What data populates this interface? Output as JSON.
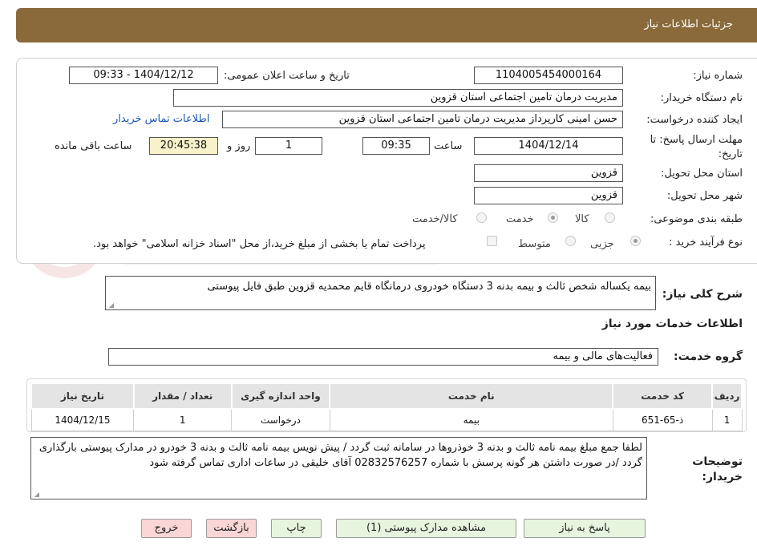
{
  "header": {
    "title": "جزئیات اطلاعات نیاز"
  },
  "form": {
    "need_number_label": "شماره نیاز:",
    "need_number": "1104005454000164",
    "announce_label": "تاریخ و ساعت اعلان عمومی:",
    "announce_value": "1404/12/12 - 09:33",
    "buyer_label": "نام دستگاه خریدار:",
    "buyer_value": "مدیریت درمان تامین اجتماعی استان قزوین",
    "creator_label": "ایجاد کننده درخواست:",
    "creator_value": "حسن امینی کارپرداز مدیریت درمان تامین اجتماعی استان قزوین",
    "contact_link": "اطلاعات تماس خریدار",
    "deadline_label": "مهلت ارسال پاسخ: تا تاریخ:",
    "deadline_date": "1404/12/14",
    "time_label": "ساعت",
    "deadline_time": "09:35",
    "days_value": "1",
    "days_label": "روز و",
    "remaining_value": "20:45:38",
    "remaining_label": "ساعت باقی مانده",
    "province_label": "استان محل تحویل:",
    "province_value": "قزوین",
    "city_label": "شهر محل تحویل:",
    "city_value": "قزوین",
    "category_label": "طبقه بندی موضوعی:",
    "category_options": [
      "کالا",
      "خدمت",
      "کالا/خدمت"
    ],
    "process_label": "نوع فرآیند خرید :",
    "process_options": [
      "جزیی",
      "متوسط"
    ],
    "payment_note": "پرداخت تمام یا بخشی از مبلغ خرید،از محل \"اسناد خزانه اسلامی\" خواهد بود."
  },
  "summary": {
    "label": "شرح کلی نیاز:",
    "value": "بیمه یکساله شخص ثالث و بیمه بدنه 3 دستگاه خودروی درمانگاه قایم محمدیه قزوین  طبق فایل پیوستی"
  },
  "services": {
    "section_title": "اطلاعات خدمات مورد نیاز",
    "group_label": "گروه خدمت:",
    "group_value": "فعالیت‌های مالی و بیمه",
    "columns": [
      "ردیف",
      "کد خدمت",
      "نام خدمت",
      "واحد اندازه گیری",
      "تعداد / مقدار",
      "تاریخ نیاز"
    ],
    "rows": [
      [
        "1",
        "ذ-65-651",
        "بیمه",
        "درخواست",
        "1",
        "1404/12/15"
      ]
    ]
  },
  "notes": {
    "label": "توضیحات خریدار:",
    "value": "لطفا جمع مبلغ  بیمه نامه ثالث و بدنه 3 خوذروها در سامانه ثبت گردد / پیش نویس بیمه نامه  ثالث و بدنه 3 خودرو در مدارک پیوستی بارگذاری گردد /در صورت داشتن هر گونه پرسش با شماره 02832576257 آقای خلیقی در ساعات اداری تماس گرفته شود"
  },
  "buttons": {
    "reply": "پاسخ به نیاز",
    "attachments": "مشاهده مدارک پیوستی (1)",
    "print": "چاپ",
    "back": "بازگشت",
    "exit": "خروج"
  },
  "colors": {
    "header_bg": "#8a6a3b",
    "link": "#1a56b8",
    "remaining_bg": "#f7f2c9"
  }
}
